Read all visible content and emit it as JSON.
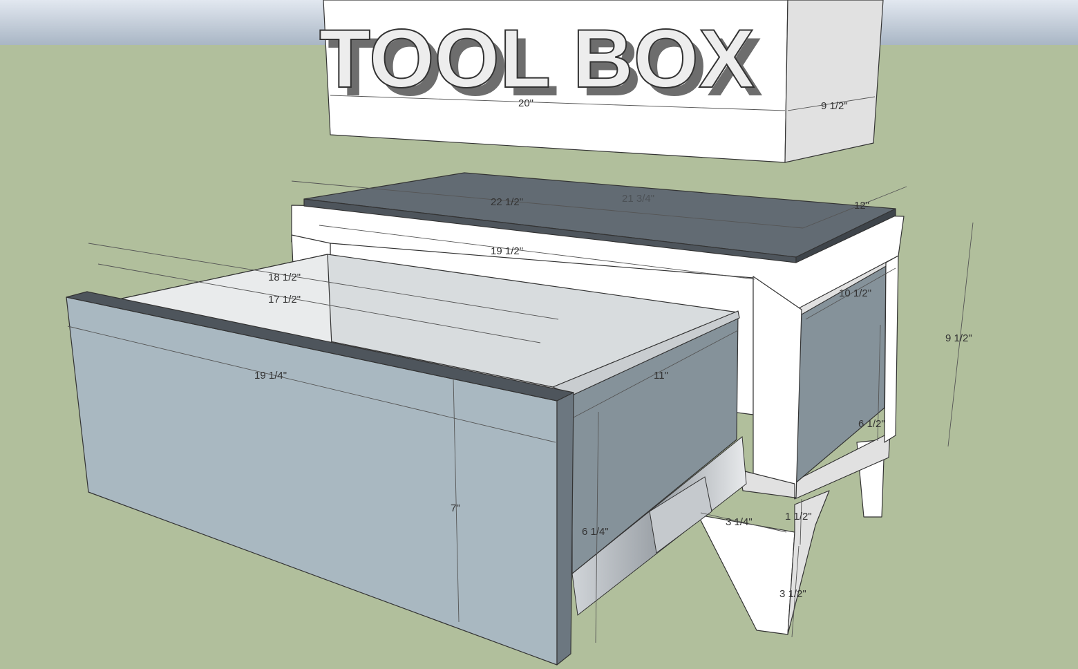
{
  "colors": {
    "sky_top": "#e2e8f0",
    "sky_bottom": "#a9b6c5",
    "ground": "#b1bf9c",
    "wood_white": "#ffffff",
    "wood_shade": "#e1e1e1",
    "lid_top": "#626b73",
    "drawer_front": "#a9b8c1",
    "drawer_side": "#85929a",
    "edge": "#333333"
  },
  "toolbox": {
    "title": "TOOL BOX"
  },
  "dimensions": {
    "top_width": "20\"",
    "top_depth": "9 1/2\"",
    "lid_length": "22 1/2\"",
    "lid_hidden": "21 3/4\"",
    "lid_depth": "12\"",
    "cabinet_inner_width": "19 1/2\"",
    "drawer_outer_length": "18 1/2\"",
    "drawer_inner_length": "17 1/2\"",
    "drawer_front_width": "19 1/4\"",
    "drawer_depth": "11\"",
    "panel_depth": "10 1/2\"",
    "cabinet_height": "9 1/2\"",
    "panel_height": "6 1/2\"",
    "drawer_front_height": "7\"",
    "drawer_side_height": "6 1/4\"",
    "leg_width": "3 1/4\"",
    "rail_height": "1 1/2\"",
    "leg_height": "3 1/2\""
  }
}
